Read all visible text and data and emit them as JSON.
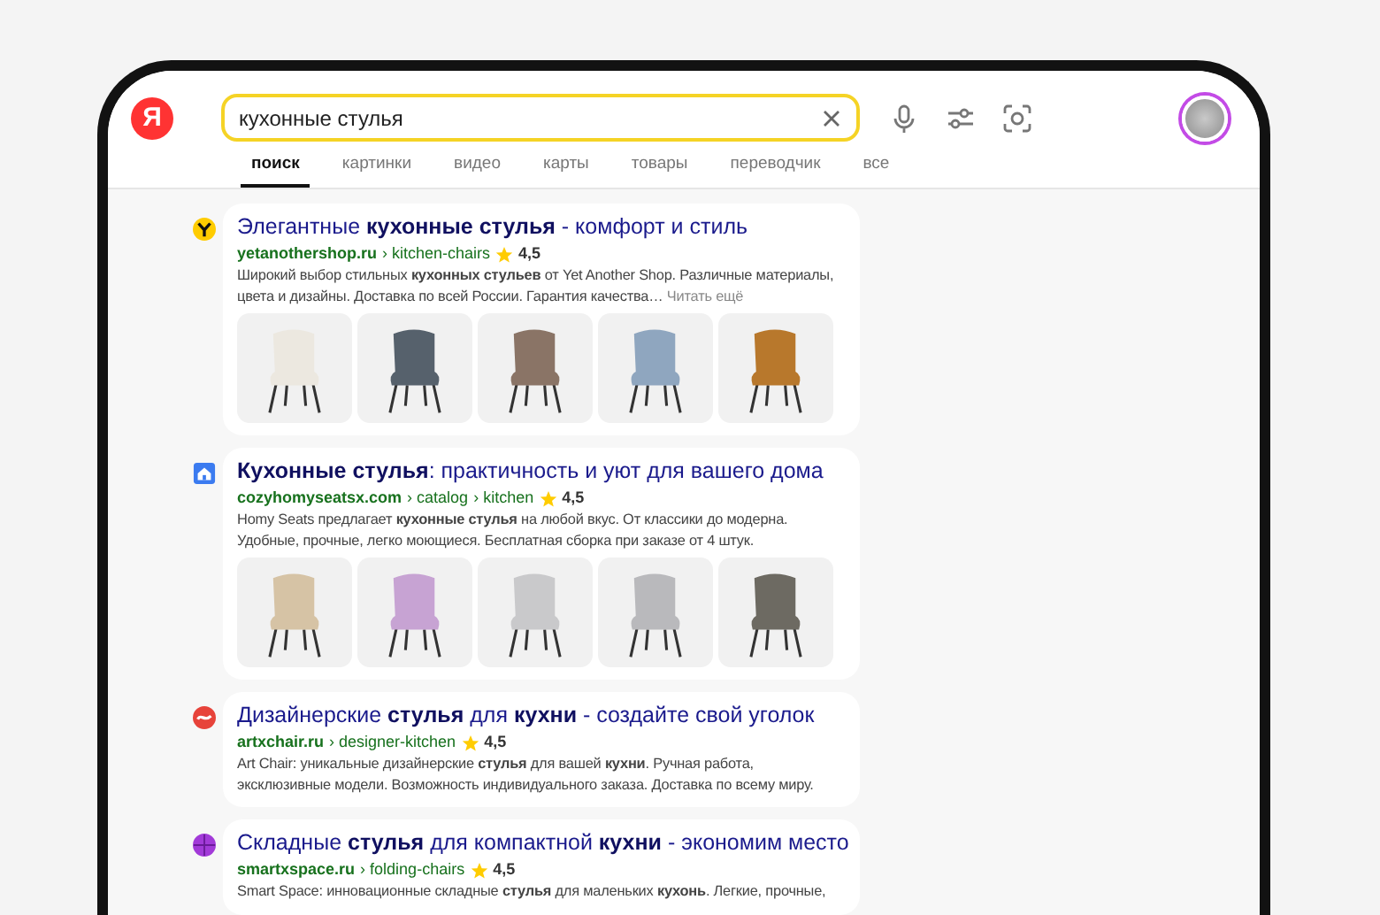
{
  "header": {
    "logo": "Я",
    "search": {
      "value": "кухонные стулья"
    }
  },
  "tabs": [
    {
      "label": "поиск",
      "selected": true
    },
    {
      "label": "картинки",
      "selected": false
    },
    {
      "label": "видео",
      "selected": false
    },
    {
      "label": "карты",
      "selected": false
    },
    {
      "label": "товары",
      "selected": false
    },
    {
      "label": "переводчик",
      "selected": false
    },
    {
      "label": "все",
      "selected": false
    }
  ],
  "results": [
    {
      "favicon": {
        "kind": "y"
      },
      "title": "Элегантные **кухонные стулья** - комфорт и стиль",
      "site": "yetanothershop.ru",
      "path": [
        "› kitchen-chairs"
      ],
      "rating": "4,5",
      "snippet": "Широкий выбор стильных **кухонных стульев** от Yet Another Shop. Различные материалы, цвета и дизайны. Доставка по всей России. Гарантия качества…",
      "more": "Читать ещё",
      "images": [
        {
          "color": "#ece8e0"
        },
        {
          "color": "#56616c"
        },
        {
          "color": "#8a7466"
        },
        {
          "color": "#8fa6bf"
        },
        {
          "color": "#b8782c"
        }
      ]
    },
    {
      "favicon": {
        "kind": "house"
      },
      "title": "**Кухонные стулья**: практичность и уют для вашего дома",
      "site": "cozyhomyseatsx.com",
      "path": [
        "› catalog",
        "› kitchen"
      ],
      "rating": "4,5",
      "snippet": "Homy Seats предлагает **кухонные стулья** на любой вкус. От классики до модерна. Удобные, прочные, легко моющиеся. Бесплатная сборка при заказе от 4 штук.",
      "images": [
        {
          "color": "#d6c3a5"
        },
        {
          "color": "#c7a3d3"
        },
        {
          "color": "#c9c9cb"
        },
        {
          "color": "#b9b9bc"
        },
        {
          "color": "#6d6a62"
        }
      ]
    },
    {
      "favicon": {
        "kind": "swirl"
      },
      "title": "Дизайнерские **стулья** для **кухни** - создайте свой уголок",
      "site": "artxchair.ru",
      "path": [
        "› designer-kitchen"
      ],
      "rating": "4,5",
      "snippet": "Art Chair: уникальные дизайнерские **стулья** для вашей **кухни**. Ручная работа, эксклюзивные модели. Возможность индивидуального заказа. Доставка по всему миру."
    },
    {
      "favicon": {
        "kind": "globe"
      },
      "title": "Складные **стулья** для компактной **кухни** - экономим место",
      "site": "smartxspace.ru",
      "path": [
        "› folding-chairs"
      ],
      "rating": "4,5",
      "snippet": "Smart Space: инновационные складные **стулья** для маленьких **кухонь**. Легкие, прочные,"
    }
  ]
}
